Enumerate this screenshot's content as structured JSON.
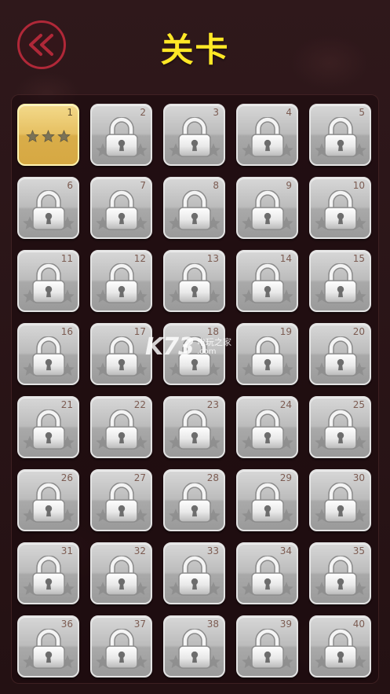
{
  "header": {
    "title": "关卡",
    "back_icon": "double-chevron-left-icon",
    "accent_color": "#b02838",
    "title_color": "#ffe826"
  },
  "levels": [
    {
      "number": "1",
      "status": "unlocked",
      "stars": 3
    },
    {
      "number": "2",
      "status": "locked"
    },
    {
      "number": "3",
      "status": "locked"
    },
    {
      "number": "4",
      "status": "locked"
    },
    {
      "number": "5",
      "status": "locked"
    },
    {
      "number": "6",
      "status": "locked"
    },
    {
      "number": "7",
      "status": "locked"
    },
    {
      "number": "8",
      "status": "locked"
    },
    {
      "number": "9",
      "status": "locked"
    },
    {
      "number": "10",
      "status": "locked"
    },
    {
      "number": "11",
      "status": "locked"
    },
    {
      "number": "12",
      "status": "locked"
    },
    {
      "number": "13",
      "status": "locked"
    },
    {
      "number": "14",
      "status": "locked"
    },
    {
      "number": "15",
      "status": "locked"
    },
    {
      "number": "16",
      "status": "locked"
    },
    {
      "number": "17",
      "status": "locked"
    },
    {
      "number": "18",
      "status": "locked"
    },
    {
      "number": "19",
      "status": "locked"
    },
    {
      "number": "20",
      "status": "locked"
    },
    {
      "number": "21",
      "status": "locked"
    },
    {
      "number": "22",
      "status": "locked"
    },
    {
      "number": "23",
      "status": "locked"
    },
    {
      "number": "24",
      "status": "locked"
    },
    {
      "number": "25",
      "status": "locked"
    },
    {
      "number": "26",
      "status": "locked"
    },
    {
      "number": "27",
      "status": "locked"
    },
    {
      "number": "28",
      "status": "locked"
    },
    {
      "number": "29",
      "status": "locked"
    },
    {
      "number": "30",
      "status": "locked"
    },
    {
      "number": "31",
      "status": "locked"
    },
    {
      "number": "32",
      "status": "locked"
    },
    {
      "number": "33",
      "status": "locked"
    },
    {
      "number": "34",
      "status": "locked"
    },
    {
      "number": "35",
      "status": "locked"
    },
    {
      "number": "36",
      "status": "locked"
    },
    {
      "number": "37",
      "status": "locked"
    },
    {
      "number": "38",
      "status": "locked"
    },
    {
      "number": "39",
      "status": "locked"
    },
    {
      "number": "40",
      "status": "locked"
    }
  ],
  "icons": {
    "locked": "padlock-icon",
    "star": "star-icon"
  },
  "watermark": {
    "logo": "K73",
    "site_name": "电玩之家",
    "url": ".com"
  }
}
